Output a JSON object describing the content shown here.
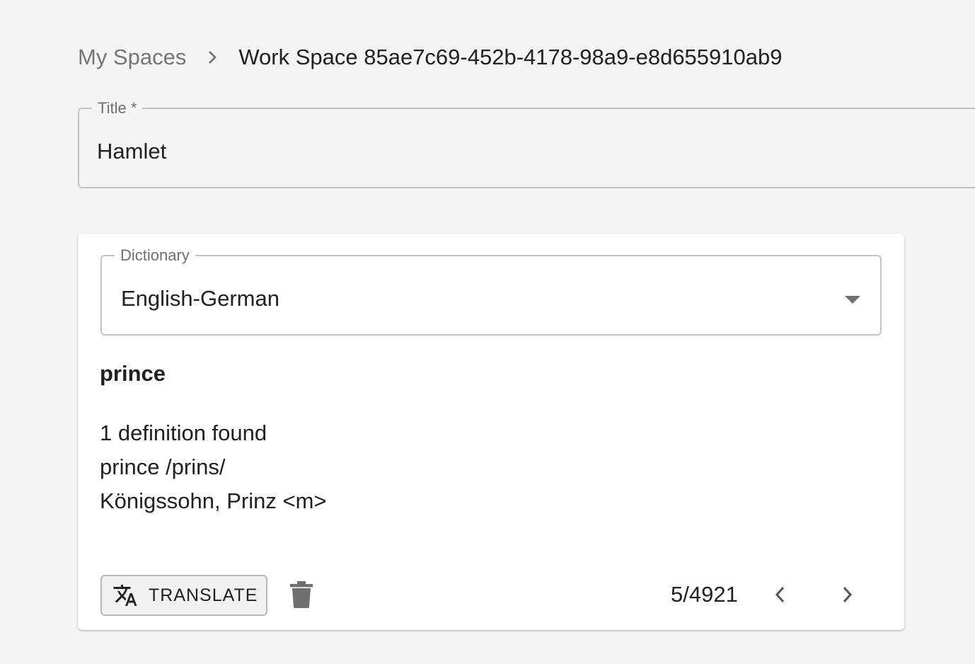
{
  "breadcrumb": {
    "root": "My Spaces",
    "current": "Work Space 85ae7c69-452b-4178-98a9-e8d655910ab9",
    "separator_icon": "chevron-right-icon"
  },
  "title_field": {
    "label": "Title *",
    "value": "Hamlet"
  },
  "dictionary": {
    "label": "Dictionary",
    "selected": "English-German",
    "dropdown_icon": "caret-down-icon"
  },
  "lookup": {
    "word": "prince",
    "lines": [
      "1 definition found",
      "prince /prins/",
      "Königssohn, Prinz <m>"
    ]
  },
  "actions": {
    "translate_label": "TRANSLATE",
    "translate_icon": "translate-icon",
    "delete_icon": "trash-icon"
  },
  "pagination": {
    "counter": "5/4921",
    "prev_icon": "chevron-left-icon",
    "next_icon": "chevron-right-icon"
  },
  "colors": {
    "background": "#f4f4f4",
    "card": "#ffffff",
    "text": "#212121",
    "muted": "#757575",
    "border": "#c4c4c4",
    "icon": "#6f6f6f"
  }
}
